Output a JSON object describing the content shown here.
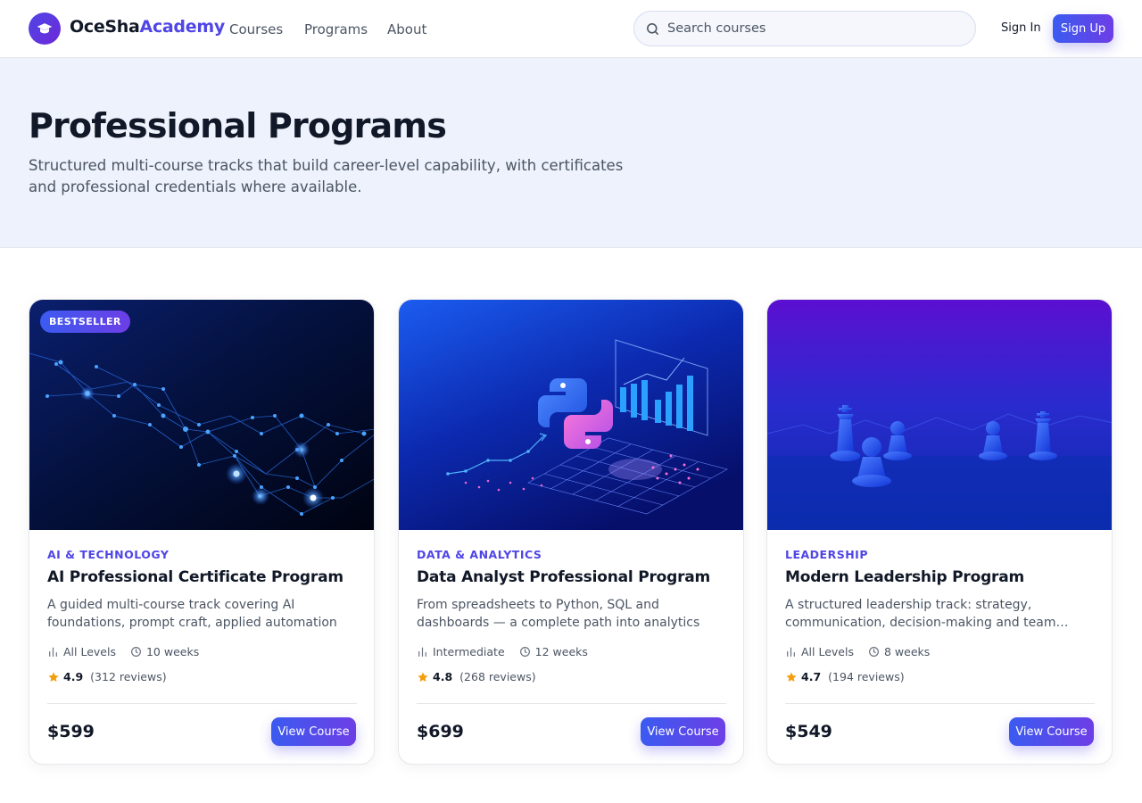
{
  "brand": {
    "name_part1": "OceSha",
    "name_part2": "Academy"
  },
  "nav": [
    {
      "label": "Courses"
    },
    {
      "label": "Programs"
    },
    {
      "label": "About"
    }
  ],
  "search": {
    "placeholder": "Search courses"
  },
  "auth": {
    "signin": "Sign In",
    "signup": "Sign Up"
  },
  "hero": {
    "title": "Professional Programs",
    "subtitle": "Structured multi-course tracks that build career-level capability, with certificates and professional credentials where available."
  },
  "cards": [
    {
      "badge": "BESTSELLER",
      "category": "AI & TECHNOLOGY",
      "title": "AI Professional Certificate Program",
      "description": "A guided multi-course track covering AI foundations, prompt craft, applied automation and governance.",
      "level": "All Levels",
      "duration": "10 weeks",
      "rating": "4.9",
      "reviews": "(312 reviews)",
      "price": "$599",
      "cta": "View Course",
      "image_icon": "neural-network-icon"
    },
    {
      "category": "DATA & ANALYTICS",
      "title": "Data Analyst Professional Program",
      "description": "From spreadsheets to Python, SQL and dashboards — a complete path into analytics roles.",
      "level": "Intermediate",
      "duration": "12 weeks",
      "rating": "4.8",
      "reviews": "(268 reviews)",
      "price": "$699",
      "cta": "View Course",
      "image_icon": "python-chart-icon"
    },
    {
      "category": "LEADERSHIP",
      "title": "Modern Leadership Program",
      "description": "A structured leadership track: strategy, communication, decision-making and team building.",
      "level": "All Levels",
      "duration": "8 weeks",
      "rating": "4.7",
      "reviews": "(194 reviews)",
      "price": "$549",
      "cta": "View Course",
      "image_icon": "chess-pieces-icon"
    }
  ],
  "colors": {
    "accent": "#4f46e5",
    "accent2": "#6d3ee6",
    "star": "#f59e0b",
    "hero_bg": "#eef2fc"
  }
}
